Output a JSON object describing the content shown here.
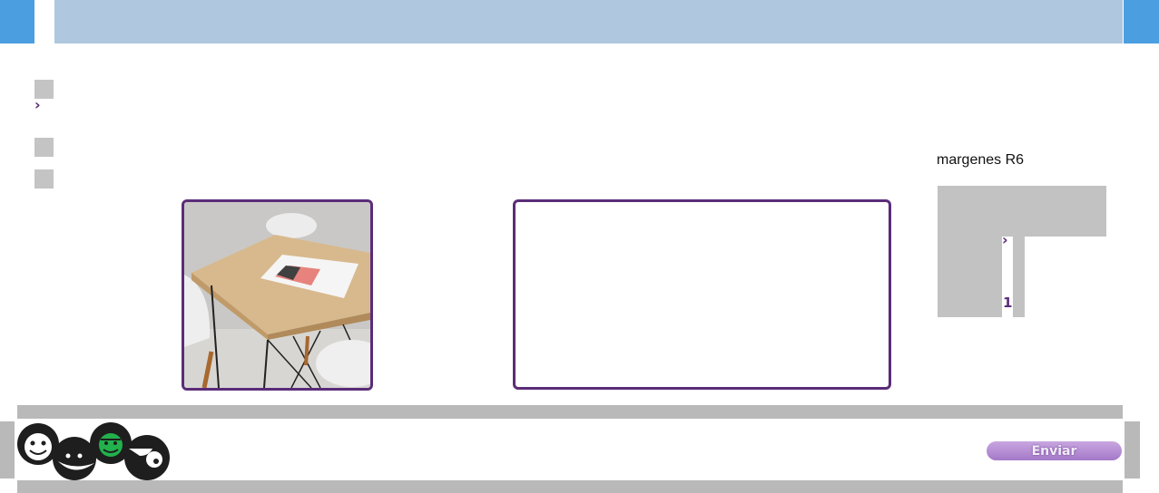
{
  "right_panel": {
    "title": "margenes R6",
    "page_number": "1"
  },
  "footer": {
    "send_label": "Enviar"
  },
  "icons": {
    "left_chevron": "chevron-right-icon",
    "panel_chevron": "chevron-right-icon",
    "logo": "faces-logo-icon"
  },
  "colors": {
    "accent": "#5b2c78",
    "header_blue": "#4b9fe0",
    "header_bar": "#afc7df",
    "button": "#a479c9",
    "logo_green": "#22b14c"
  }
}
